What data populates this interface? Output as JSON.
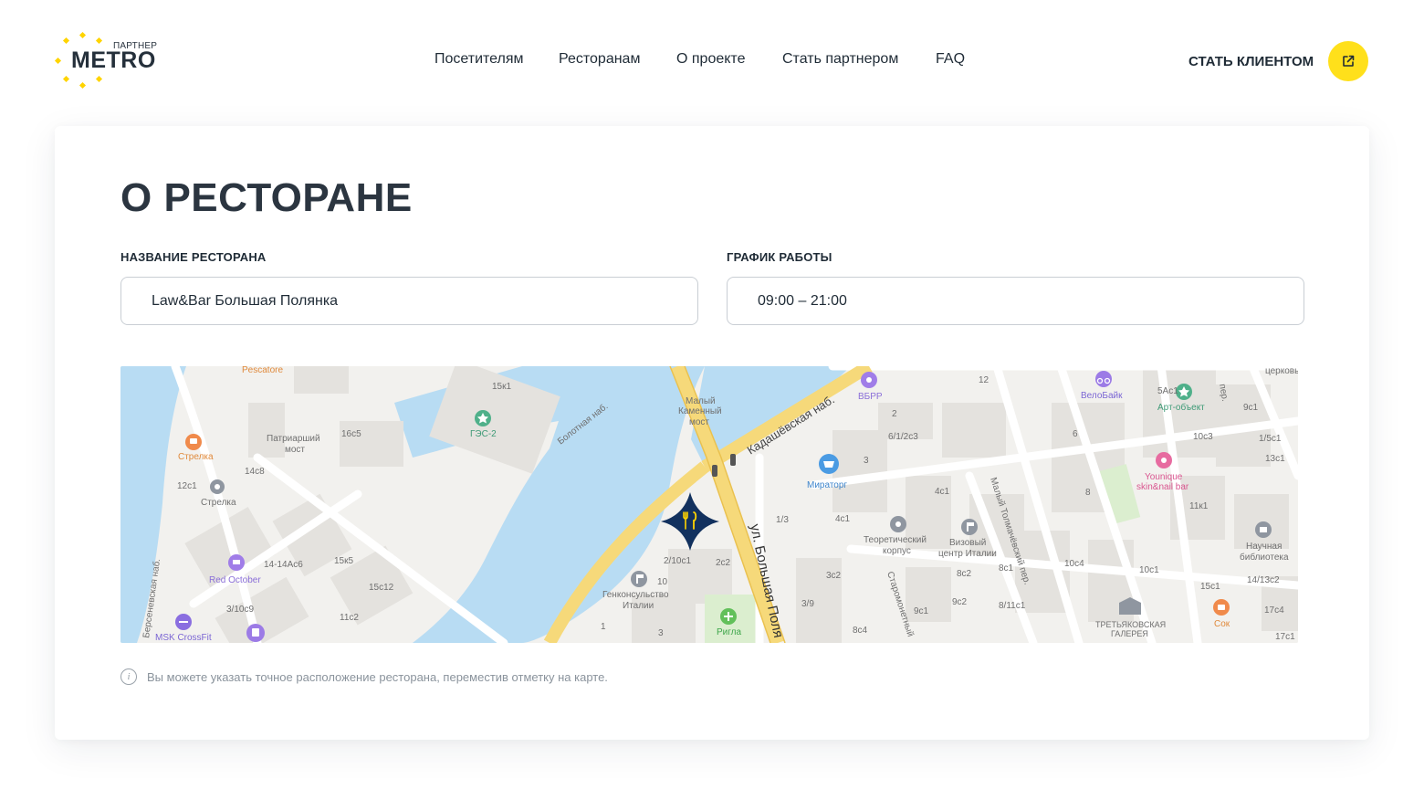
{
  "header": {
    "logo": {
      "partner": "ПАРТНЕР",
      "brand": "METRO",
      "dot_color": "#ffd400"
    },
    "nav": [
      {
        "label": "Посетителям"
      },
      {
        "label": "Ресторанам"
      },
      {
        "label": "О проекте"
      },
      {
        "label": "Стать партнером"
      },
      {
        "label": "FAQ"
      }
    ],
    "cta": {
      "label": "СТАТЬ КЛИЕНТОМ",
      "icon": "external-link-icon",
      "color": "#ffe01b"
    }
  },
  "main": {
    "title": "О РЕСТОРАНЕ",
    "fields": {
      "name": {
        "label": "НАЗВАНИЕ РЕСТОРАНА",
        "value": "Law&Bar Большая Полянка"
      },
      "hours": {
        "label": "ГРАФИК РАБОТЫ",
        "value": "09:00 – 21:00"
      }
    },
    "map": {
      "marker_icon": "restaurant-fork-knife-icon",
      "marker_color": "#12315e",
      "water_color": "#b8dcf3",
      "road_color": "#f6d97a",
      "labels": {
        "pescatore": "Pescatore",
        "strelka_orange": "Стрелка",
        "strelka": "Стрелка",
        "patriarshy1": "Патриарший",
        "patriarshy2": "мост",
        "n16c5": "16с5",
        "n14c8": "14с8",
        "n12c1": "12с1",
        "n15k1": "15к1",
        "ges2": "ГЭС-2",
        "bolotnaya": "Болотная наб.",
        "maly1": "Малый",
        "maly2": "Каменный",
        "maly3": "мост",
        "kadash": "Кадашёвская наб.",
        "vbrr": "ВБРР",
        "n12": "12",
        "velobike": "ВелоБайк",
        "art": "Арт-объект",
        "per": "пер.",
        "church": "церковь",
        "miratorg": "Мираторг",
        "n2": "2",
        "n6_1_2c3": "6/1/2с3",
        "n3": "3",
        "n6": "6",
        "n5ac1": "5Ас1",
        "n9c1": "9с1",
        "n10c3": "10с3",
        "n1_5c1": "1/5с1",
        "n13c1": "13с1",
        "younique1": "Younique",
        "younique2": "skin&nail bar",
        "n8": "8",
        "n11k1": "11к1",
        "n4c1a": "4с1",
        "n4c1b": "4с1",
        "n1_3": "1/3",
        "teor1": "Теоретический",
        "teor2": "корпус",
        "viz1": "Визовый",
        "viz2": "центр Италии",
        "tolmach": "Малый Толмачёвский пер.",
        "naych1": "Научная",
        "naych2": "библиотека",
        "n14_13c2": "14/13с2",
        "n2_10c1": "2/10с1",
        "n2c2": "2с2",
        "n10": "10",
        "genkon1": "Генконсульство",
        "genkon2": "Италии",
        "polyanka": "ул. Большая Поля",
        "n3c2": "3с2",
        "n8c2": "8с2",
        "n8c1": "8с1",
        "n10c4": "10с4",
        "n10c1": "10с1",
        "n15c1": "15с1",
        "n17c4": "17с4",
        "staromon": "Старомонетный",
        "n9c2": "9с2",
        "n8_11c1": "8/11с1",
        "tretyak1": "ТРЕТЬЯКОВСКАЯ",
        "tretyak2": "ГАЛЕРЕЯ",
        "sok": "Сок",
        "n17c1": "17с1",
        "n3_9": "3/9",
        "n8c4": "8с4",
        "n1": "1",
        "n3b": "3",
        "rigla": "Ригла",
        "redoct": "Red October",
        "n14_14ac6": "14-14Ас6",
        "n15k5": "15к5",
        "n15c12": "15с12",
        "n3_10c9": "3/10с9",
        "n11c2": "11с2",
        "msk": "MSK CrossFit",
        "bersen": "Берсеневская наб."
      }
    },
    "hint": {
      "icon": "info-icon",
      "text": "Вы можете указать точное расположение ресторана, переместив отметку на карте."
    }
  }
}
